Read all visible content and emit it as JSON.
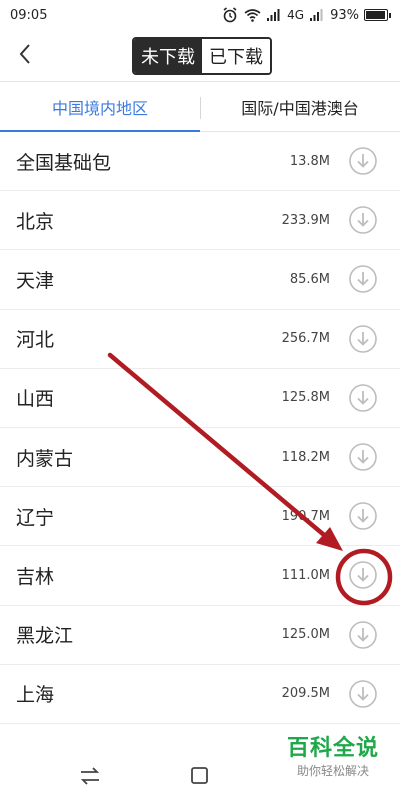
{
  "status_bar": {
    "time": "09:05",
    "network": "4G",
    "battery_pct": "93%",
    "battery_level": 0.93,
    "icons": [
      "alarm-icon",
      "wifi-icon",
      "signal-icon",
      "signal-icon",
      "battery-icon"
    ]
  },
  "header": {
    "back_icon": "chevron-left-icon",
    "seg_not_downloaded": "未下载",
    "seg_downloaded": "已下载",
    "selected": "未下载"
  },
  "tabs": {
    "domestic": "中国境内地区",
    "international": "国际/中国港澳台",
    "selected": "中国境内地区"
  },
  "colors": {
    "accent": "#3b7be0",
    "annotation": "#b01c22",
    "watermark": "#1fa84a"
  },
  "regions": [
    {
      "name": "全国基础包",
      "size": "13.8M"
    },
    {
      "name": "北京",
      "size": "233.9M"
    },
    {
      "name": "天津",
      "size": "85.6M"
    },
    {
      "name": "河北",
      "size": "256.7M"
    },
    {
      "name": "山西",
      "size": "125.8M"
    },
    {
      "name": "内蒙古",
      "size": "118.2M"
    },
    {
      "name": "辽宁",
      "size": "190.7M"
    },
    {
      "name": "吉林",
      "size": "111.0M"
    },
    {
      "name": "黑龙江",
      "size": "125.0M"
    },
    {
      "name": "上海",
      "size": "209.5M"
    }
  ],
  "watermark": {
    "title": "百科全说",
    "subtitle": "助你轻松解决"
  }
}
